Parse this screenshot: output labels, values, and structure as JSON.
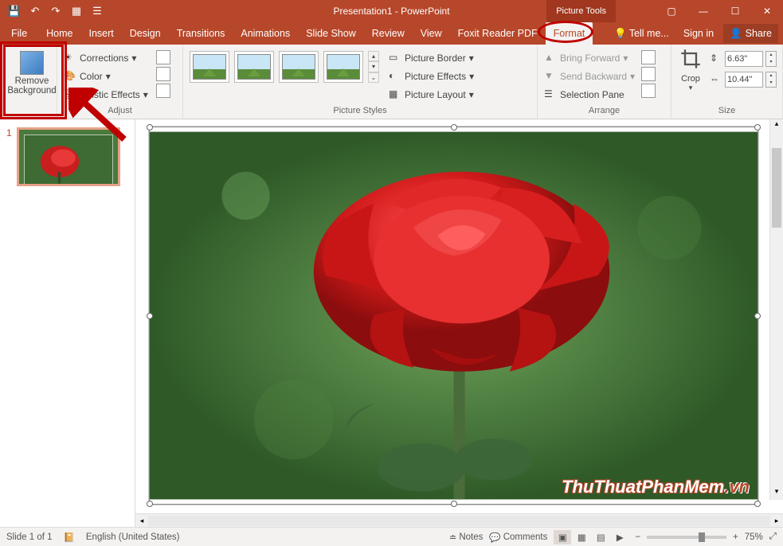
{
  "titlebar": {
    "title": "Presentation1 - PowerPoint",
    "contextual_label": "Picture Tools",
    "qat": {
      "save": "save-icon",
      "undo": "undo-icon",
      "redo": "redo-icon",
      "start": "start-from-beginning-icon",
      "touch": "touch-mode-icon"
    }
  },
  "tabs": {
    "file": "File",
    "items": [
      "Home",
      "Insert",
      "Design",
      "Transitions",
      "Animations",
      "Slide Show",
      "Review",
      "View",
      "Foxit Reader PDF"
    ],
    "active": "Format",
    "tellme": "Tell me...",
    "signin": "Sign in",
    "share": "Share"
  },
  "ribbon": {
    "removebg": {
      "line1": "Remove",
      "line2": "Background"
    },
    "adjust": {
      "corrections": "Corrections",
      "color": "Color",
      "artistic": "Artistic Effects",
      "label": "Adjust"
    },
    "pstyles": {
      "border": "Picture Border",
      "effects": "Picture Effects",
      "layout": "Picture Layout",
      "label": "Picture Styles"
    },
    "arrange": {
      "forward": "Bring Forward",
      "backward": "Send Backward",
      "pane": "Selection Pane",
      "label": "Arrange"
    },
    "size": {
      "crop": "Crop",
      "height": "6.63\"",
      "width": "10.44\"",
      "label": "Size"
    }
  },
  "slides": {
    "num": "1"
  },
  "watermark": {
    "a": "ThuThuatPhanMem",
    "b": ".vn"
  },
  "statusbar": {
    "slide": "Slide 1 of 1",
    "lang": "English (United States)",
    "notes": "Notes",
    "comments": "Comments",
    "zoom": "75%"
  }
}
